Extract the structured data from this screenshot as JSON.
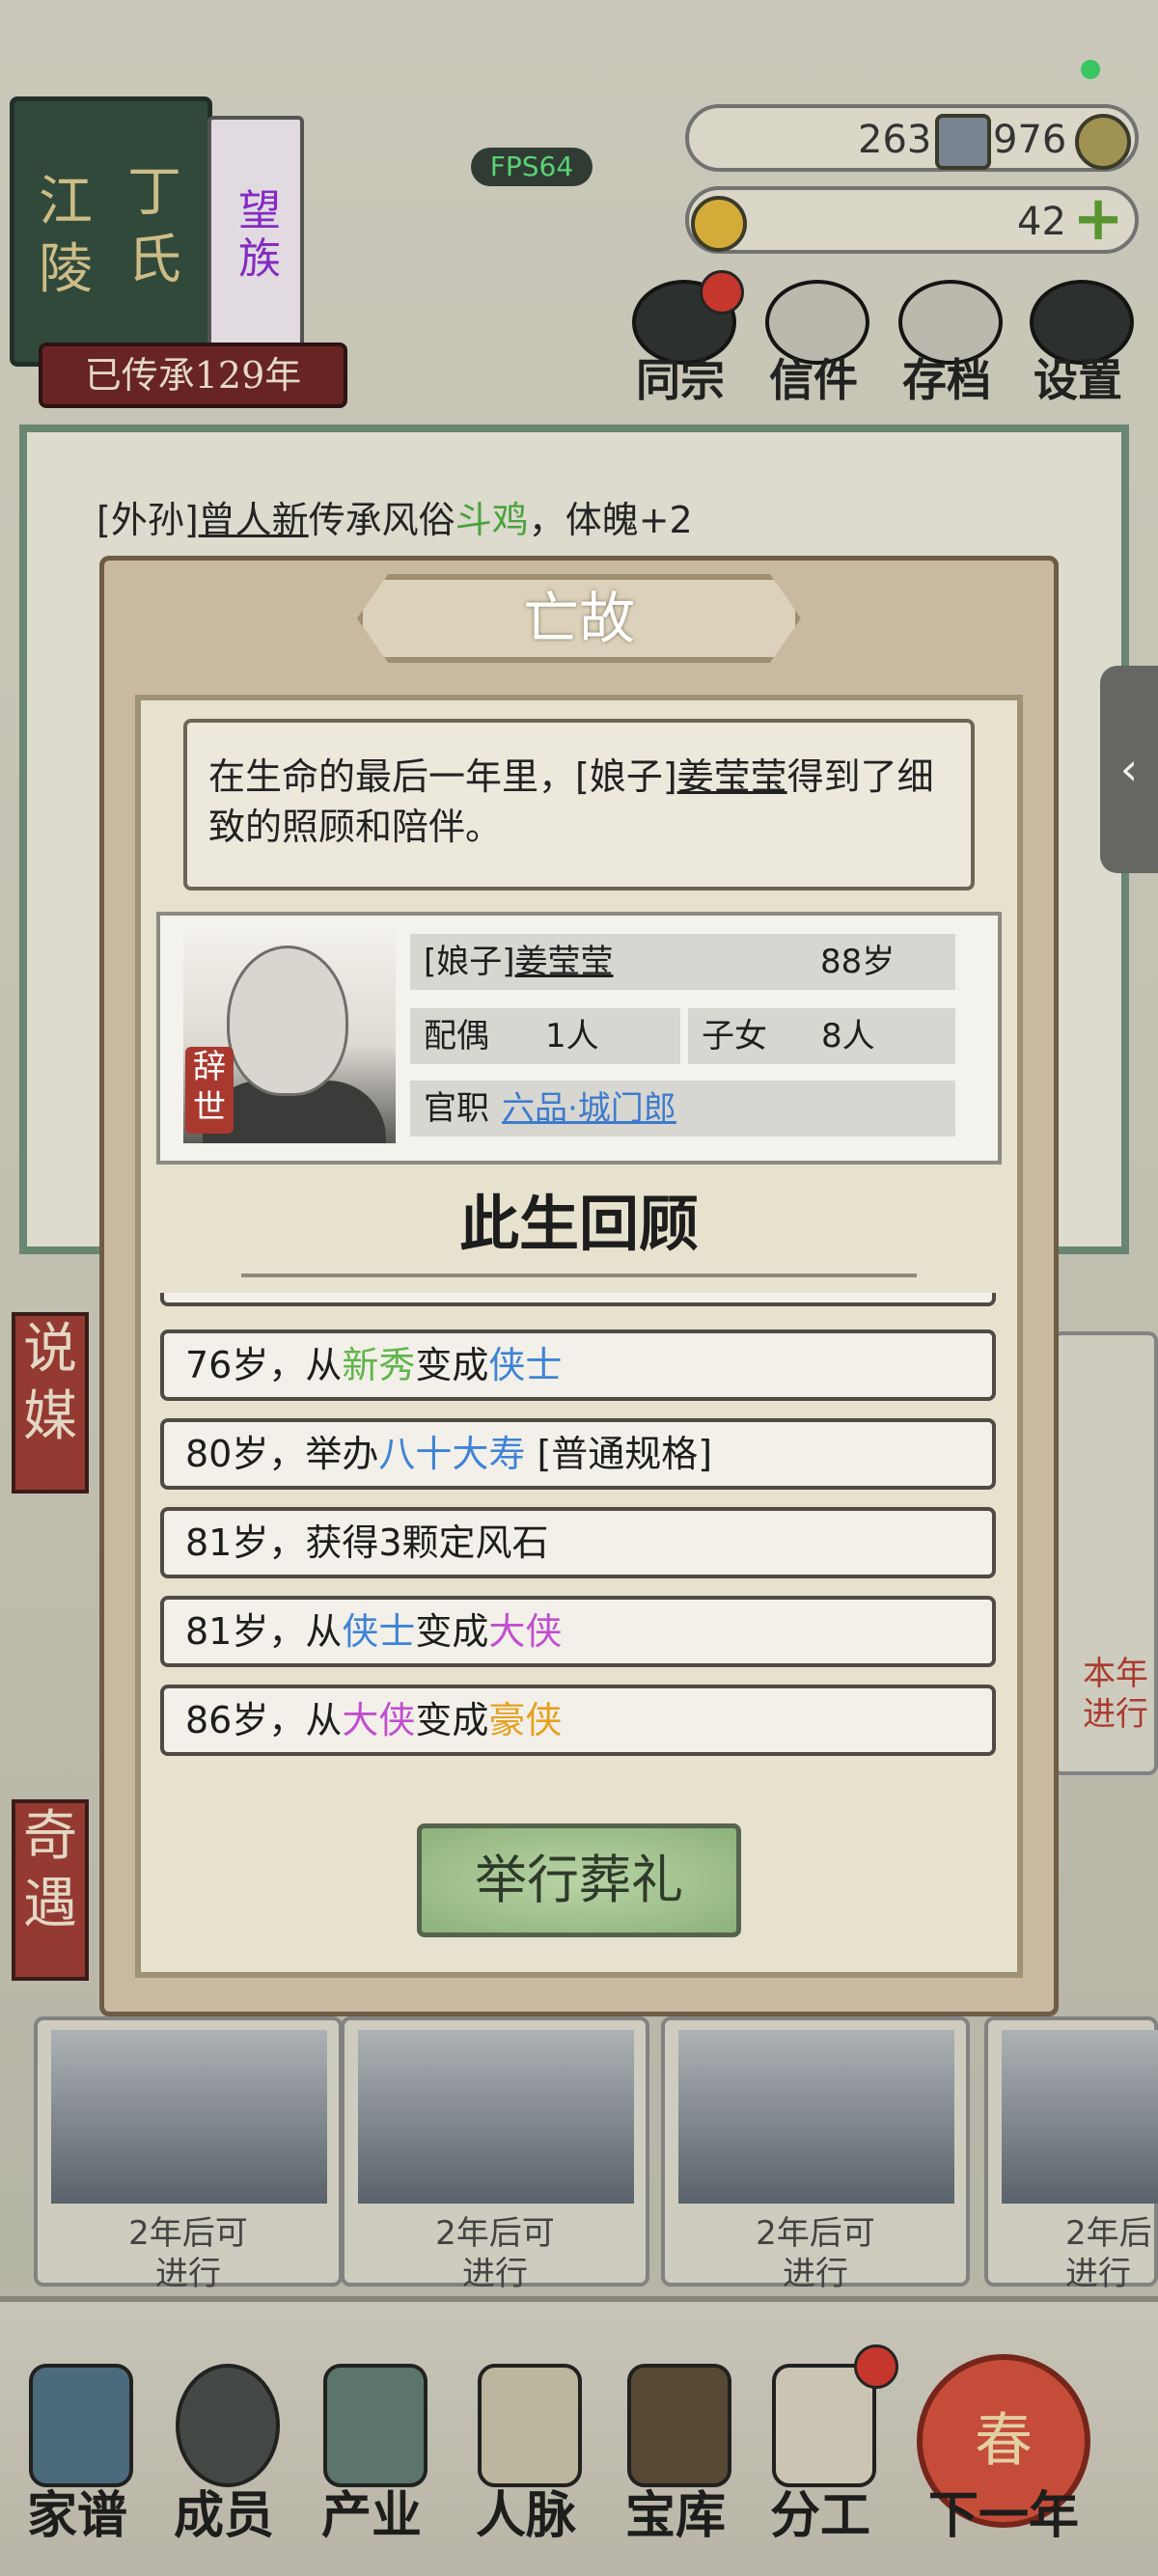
{
  "status": {
    "fps": "FPS64"
  },
  "clan": {
    "place": "江陵",
    "family": "丁氏",
    "rank": "望族",
    "inherit": "已传承129年"
  },
  "resources": {
    "row1_a": "263",
    "row1_b": "976",
    "gold": "42"
  },
  "top_buttons": [
    "同宗",
    "信件",
    "存档",
    "设置"
  ],
  "log": {
    "prefix": "[外孙]",
    "name": "曾人新",
    "mid": "传承风俗",
    "custom": "斗鸡",
    "suffix": "，体魄+2"
  },
  "side_labels": {
    "matchmaking": "说媒",
    "encounter": "奇遇"
  },
  "cards": [
    {
      "text": "2年后可\n进行"
    },
    {
      "text": "2年后可\n进行"
    },
    {
      "text": "2年后可\n进行"
    },
    {
      "text": "2年后\n进行"
    }
  ],
  "right_card_text": "本年\n进行",
  "bottom_nav": [
    "家谱",
    "成员",
    "产业",
    "人脉",
    "宝库",
    "分工",
    "下一年"
  ],
  "next_year_icon": "春",
  "modal": {
    "title": "亡故",
    "message_a": "在生命的最后一年里，[娘子]",
    "message_name": "姜莹莹",
    "message_b": "得到了细致的照顾和陪伴。",
    "stamp": "辞世",
    "person": {
      "title": "[娘子]",
      "name": "姜莹莹",
      "age": "88岁",
      "spouse_label": "配偶",
      "spouse_count": "1人",
      "children_label": "子女",
      "children_count": "8人",
      "office_label": "官职",
      "office_value": "六品·城门郎"
    },
    "review_title": "此生回顾",
    "events": [
      {
        "parts": [
          {
            "t": "76岁，从"
          },
          {
            "t": "新秀",
            "c": "#5fb54a"
          },
          {
            "t": "变成"
          },
          {
            "t": "侠士",
            "c": "#3f83d6"
          }
        ]
      },
      {
        "parts": [
          {
            "t": "80岁，举办"
          },
          {
            "t": "八十大寿",
            "c": "#3f83d6"
          },
          {
            "t": " [普通规格]"
          }
        ]
      },
      {
        "parts": [
          {
            "t": "81岁，获得3颗定风石"
          }
        ]
      },
      {
        "parts": [
          {
            "t": "81岁，从"
          },
          {
            "t": "侠士",
            "c": "#3f83d6"
          },
          {
            "t": "变成"
          },
          {
            "t": "大侠",
            "c": "#c14fd0"
          }
        ]
      },
      {
        "parts": [
          {
            "t": "86岁，从"
          },
          {
            "t": "大侠",
            "c": "#c14fd0"
          },
          {
            "t": "变成"
          },
          {
            "t": "豪侠",
            "c": "#e6a020"
          }
        ]
      }
    ],
    "button": "举行葬礼"
  }
}
